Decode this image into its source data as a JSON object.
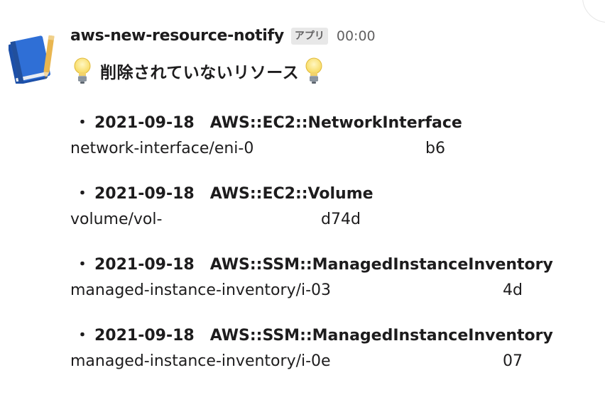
{
  "message": {
    "sender": "aws-new-resource-notify",
    "badge": "アプリ",
    "time": "00:00",
    "title": "削除されていないリソース",
    "avatar_icon": "blue-notebook-with-pencil-icon",
    "title_icon": "light-bulb-icon"
  },
  "resources": [
    {
      "bullet": "・",
      "date": "2021-09-18",
      "type": "AWS::EC2::NetworkInterface",
      "id_prefix": "network-interface/eni-0",
      "id_suffix": "b6"
    },
    {
      "bullet": "・",
      "date": "2021-09-18",
      "type": "AWS::EC2::Volume",
      "id_prefix": "volume/vol-",
      "id_suffix": "d74d"
    },
    {
      "bullet": "・",
      "date": "2021-09-18",
      "type": "AWS::SSM::ManagedInstanceInventory",
      "id_prefix": "managed-instance-inventory/i-03",
      "id_suffix": "4d"
    },
    {
      "bullet": "・",
      "date": "2021-09-18",
      "type": "AWS::SSM::ManagedInstanceInventory",
      "id_prefix": "managed-instance-inventory/i-0e",
      "id_suffix": "07"
    }
  ]
}
